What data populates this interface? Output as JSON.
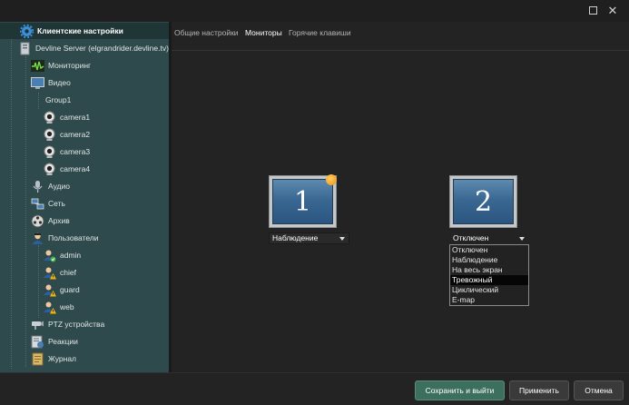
{
  "window": {
    "close_glyph": "✕"
  },
  "sidebar": {
    "items": [
      {
        "label": "Клиентские настройки",
        "icon": "gear-icon",
        "selected": true
      },
      {
        "label": "Devline Server (elgrandrider.devline.tv)",
        "icon": "server-icon"
      },
      {
        "label": "Мониторинг",
        "icon": "monitoring-icon"
      },
      {
        "label": "Видео",
        "icon": "video-monitor-icon"
      },
      {
        "label": "Group1",
        "icon": ""
      },
      {
        "label": "camera1",
        "icon": "webcam-icon"
      },
      {
        "label": "camera2",
        "icon": "webcam-icon"
      },
      {
        "label": "camera3",
        "icon": "webcam-icon"
      },
      {
        "label": "camera4",
        "icon": "webcam-icon"
      },
      {
        "label": "Аудио",
        "icon": "microphone-icon"
      },
      {
        "label": "Сеть",
        "icon": "network-icon"
      },
      {
        "label": "Архив",
        "icon": "film-reel-icon"
      },
      {
        "label": "Пользователи",
        "icon": "users-icon"
      },
      {
        "label": "admin",
        "icon": "user-ok-icon"
      },
      {
        "label": "chief",
        "icon": "user-warning-icon"
      },
      {
        "label": "guard",
        "icon": "user-warning-icon"
      },
      {
        "label": "web",
        "icon": "user-warning-icon"
      },
      {
        "label": "PTZ устройства",
        "icon": "ptz-camera-icon"
      },
      {
        "label": "Реакции",
        "icon": "reactions-icon"
      },
      {
        "label": "Журнал",
        "icon": "journal-icon"
      }
    ]
  },
  "tabs": [
    {
      "label": "Общие настройки",
      "active": false
    },
    {
      "label": "Мониторы",
      "active": true
    },
    {
      "label": "Горячие клавиши",
      "active": false
    }
  ],
  "monitors": [
    {
      "number": "1",
      "mode": "Наблюдение",
      "primary": true
    },
    {
      "number": "2",
      "mode": "Отключен",
      "primary": false
    }
  ],
  "dropdown": {
    "options": [
      "Отключен",
      "Наблюдение",
      "На весь экран",
      "Тревожный",
      "Циклический",
      "E-map"
    ],
    "highlighted_index": 3
  },
  "footer": {
    "save_exit": "Сохранить и выйти",
    "apply": "Применить",
    "cancel": "Отмена"
  },
  "colors": {
    "sidebar_bg": "#2e4a4c",
    "primary_button": "#3d6f5e"
  }
}
